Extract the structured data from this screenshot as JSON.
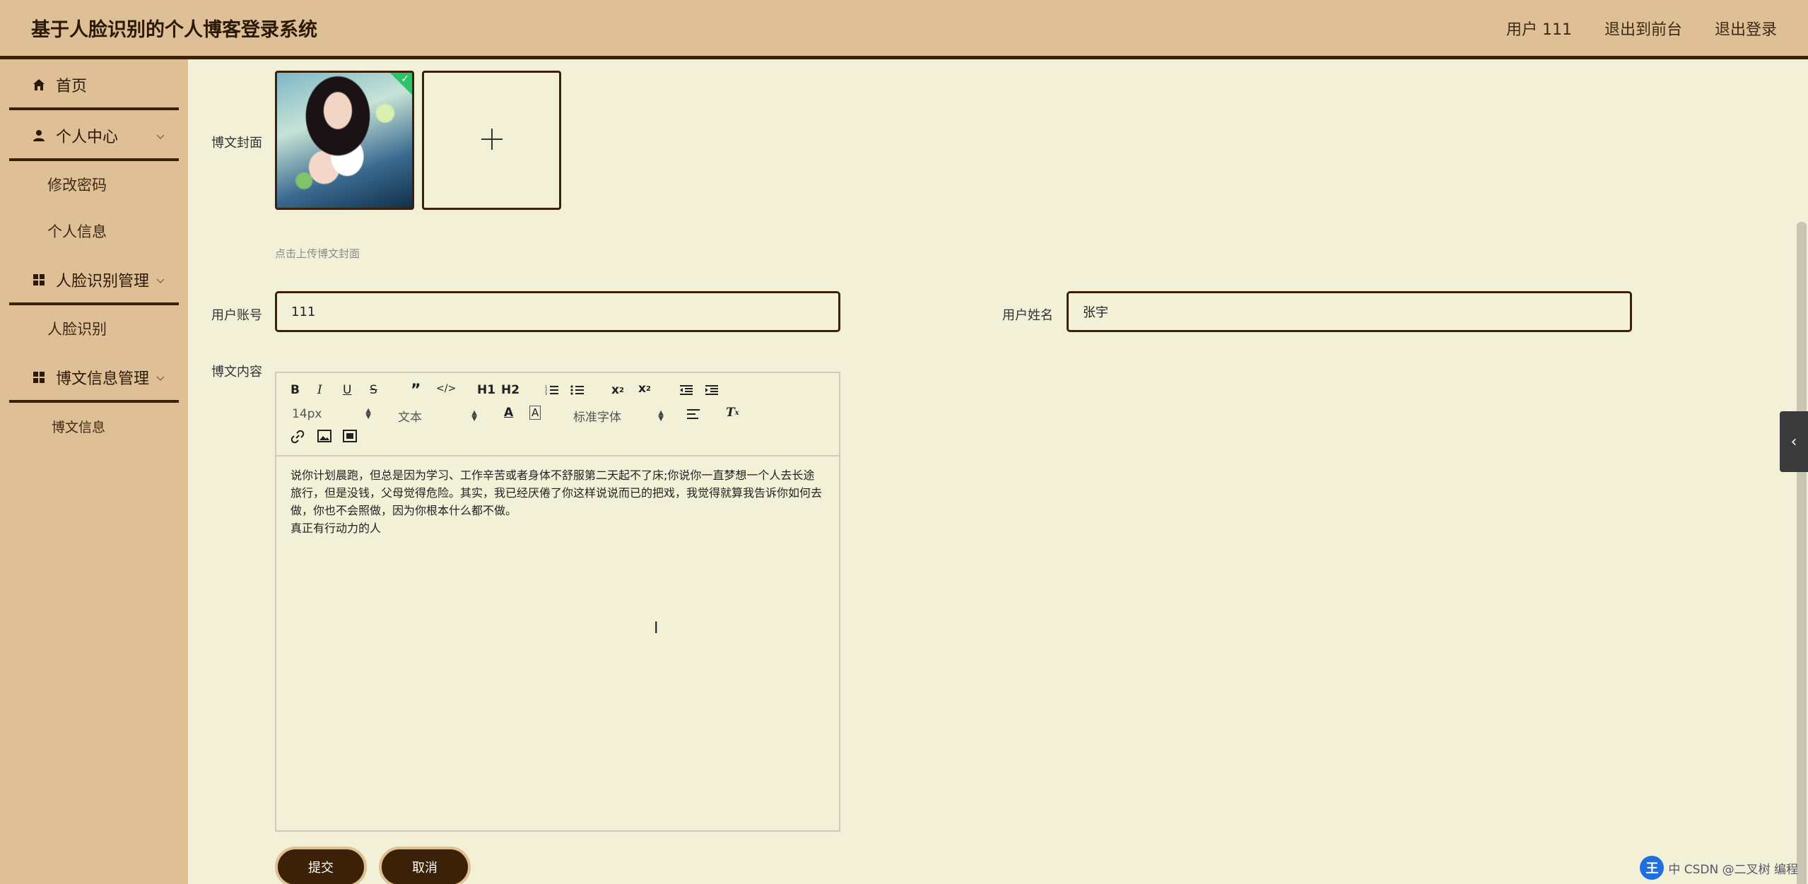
{
  "header": {
    "title": "基于人脸识别的个人博客登录系统",
    "user": "用户 111",
    "back_to_front": "退出到前台",
    "logout": "退出登录"
  },
  "sidebar": {
    "home": "首页",
    "personal_center": "个人中心",
    "change_password": "修改密码",
    "personal_info": "个人信息",
    "face_mgmt": "人脸识别管理",
    "face_recognition": "人脸识别",
    "blog_mgmt": "博文信息管理",
    "blog_info": "博文信息"
  },
  "form": {
    "cover_label": "博文封面",
    "cover_hint": "点击上传博文封面",
    "account_label": "用户账号",
    "account_value": "111",
    "name_label": "用户姓名",
    "name_value": "张宇",
    "content_label": "博文内容",
    "content_paragraph": "说你计划晨跑，但总是因为学习、工作辛苦或者身体不舒服第二天起不了床;你说你一直梦想一个人去长途旅行，但是没钱，父母觉得危险。其实，我已经厌倦了你这样说说而已的把戏，我觉得就算我告诉你如何去做，你也不会照做，因为你根本什么都不做。",
    "content_line2": "真正有行动力的人"
  },
  "editor": {
    "font_size": "14px",
    "header_select": "文本",
    "font_family": "标准字体",
    "h1": "H1",
    "h2": "H2"
  },
  "buttons": {
    "submit": "提交",
    "cancel": "取消"
  },
  "watermark": {
    "icon_text": "王",
    "text": "中 CSDN @二叉树 编程"
  },
  "colors": {
    "header_bg": "#dfc096",
    "page_bg": "#f3f0d8",
    "accent_dark": "#3b2107"
  }
}
